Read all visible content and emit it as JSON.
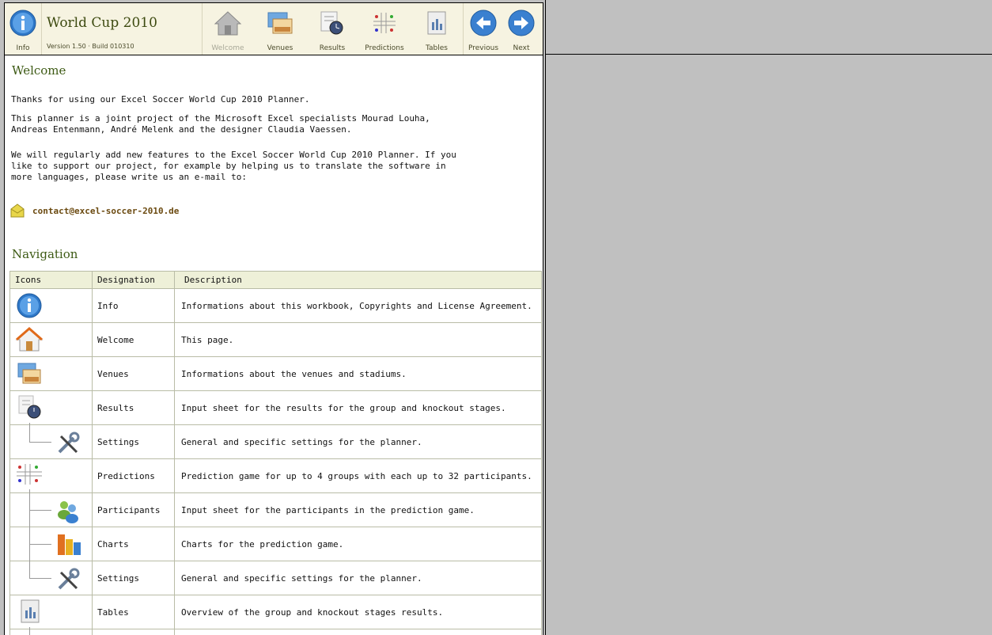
{
  "toolbar": {
    "title": "World Cup 2010",
    "version": "Version 1.50 · Build 010310",
    "buttons": {
      "info": "Info",
      "welcome": "Welcome",
      "venues": "Venues",
      "results": "Results",
      "predictions": "Predictions",
      "tables": "Tables",
      "previous": "Previous",
      "next": "Next"
    }
  },
  "welcome": {
    "heading": "Welcome",
    "p1": "Thanks for using our Excel Soccer World Cup 2010 Planner.",
    "p2": "This planner is a joint project of the Microsoft Excel specialists Mourad Louha, Andreas Entenmann, André Melenk and the designer Claudia Vaessen.",
    "p3": "We will regularly add new features to the Excel Soccer World Cup 2010 Planner. If you like to support our project, for example by helping us to translate the software in more languages, please write us an e-mail to:",
    "email": "contact@excel-soccer-2010.de"
  },
  "navigation": {
    "heading": "Navigation",
    "columns": [
      "Icons",
      "Designation",
      "Description"
    ],
    "rows": [
      {
        "icon": "info-icon",
        "designation": "Info",
        "description": "Informations about this workbook, Copyrights and License Agreement."
      },
      {
        "icon": "home-icon",
        "designation": "Welcome",
        "description": "This page."
      },
      {
        "icon": "venues-icon",
        "designation": "Venues",
        "description": "Informations about the venues and stadiums."
      },
      {
        "icon": "results-icon",
        "designation": "Results",
        "description": "Input sheet for the results for the group and knockout stages."
      },
      {
        "icon": "settings-icon",
        "designation": "Settings",
        "description": "General and specific settings for the planner."
      },
      {
        "icon": "predictions-icon",
        "designation": "Predictions",
        "description": "Prediction game for up to 4 groups with each up to 32 participants."
      },
      {
        "icon": "participants-icon",
        "designation": "Participants",
        "description": "Input sheet for the participants in the prediction game."
      },
      {
        "icon": "charts-icon",
        "designation": "Charts",
        "description": "Charts for the prediction game."
      },
      {
        "icon": "settings-icon",
        "designation": "Settings",
        "description": "General and specific settings for the planner."
      },
      {
        "icon": "tables-icon",
        "designation": "Tables",
        "description": "Overview of the group and knockout stages results."
      }
    ]
  }
}
